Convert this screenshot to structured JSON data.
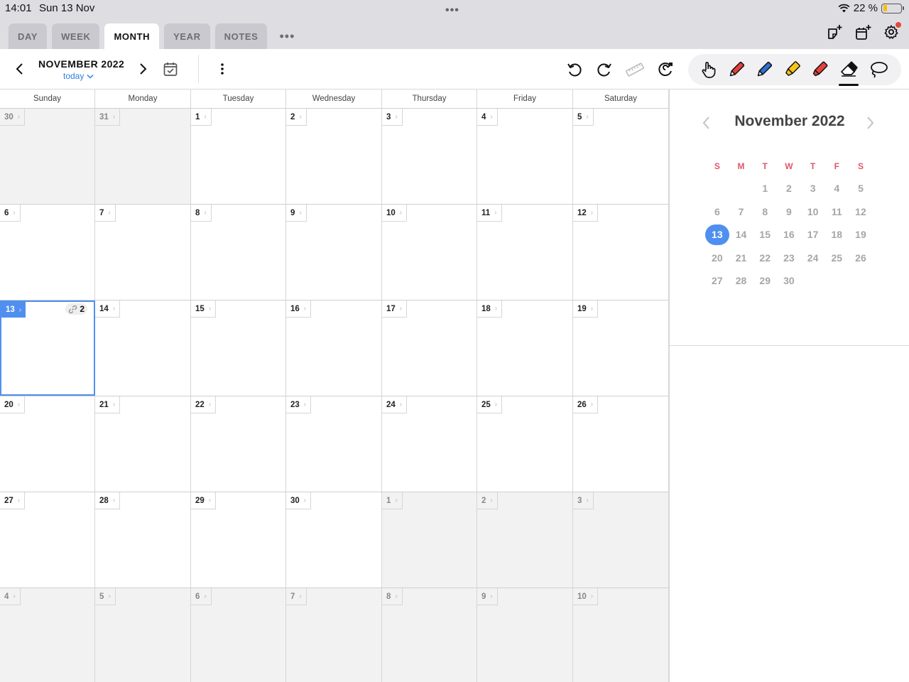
{
  "status": {
    "time": "14:01",
    "date": "Sun 13 Nov",
    "battery_text": "22 %",
    "battery_level": 0.22
  },
  "tabs": [
    {
      "label": "DAY",
      "active": false
    },
    {
      "label": "WEEK",
      "active": false
    },
    {
      "label": "MONTH",
      "active": true
    },
    {
      "label": "YEAR",
      "active": false
    },
    {
      "label": "NOTES",
      "active": false
    }
  ],
  "toolbar": {
    "month_title": "NOVEMBER 2022",
    "today_label": "today"
  },
  "colors": {
    "accent": "#4f8ff0",
    "link": "#2f7de1",
    "weekday_header": "#e0566b",
    "pen_red": "#e5413a",
    "pen_blue": "#2f6fd6",
    "highlighter_yellow": "#f5c518"
  },
  "tools": [
    "hand-icon",
    "red-pen-icon",
    "blue-pen-icon",
    "yellow-highlighter-icon",
    "red-marker-icon",
    "eraser-icon",
    "lasso-icon"
  ],
  "calendar": {
    "weekdays": [
      "Sunday",
      "Monday",
      "Tuesday",
      "Wednesday",
      "Thursday",
      "Friday",
      "Saturday"
    ],
    "weeks": [
      [
        {
          "d": "30",
          "other": true
        },
        {
          "d": "31",
          "other": true
        },
        {
          "d": "1"
        },
        {
          "d": "2"
        },
        {
          "d": "3"
        },
        {
          "d": "4"
        },
        {
          "d": "5"
        }
      ],
      [
        {
          "d": "6"
        },
        {
          "d": "7"
        },
        {
          "d": "8"
        },
        {
          "d": "9"
        },
        {
          "d": "10"
        },
        {
          "d": "11"
        },
        {
          "d": "12"
        }
      ],
      [
        {
          "d": "13",
          "today": true,
          "links": "2"
        },
        {
          "d": "14"
        },
        {
          "d": "15"
        },
        {
          "d": "16"
        },
        {
          "d": "17"
        },
        {
          "d": "18"
        },
        {
          "d": "19"
        }
      ],
      [
        {
          "d": "20"
        },
        {
          "d": "21"
        },
        {
          "d": "22"
        },
        {
          "d": "23"
        },
        {
          "d": "24"
        },
        {
          "d": "25"
        },
        {
          "d": "26"
        }
      ],
      [
        {
          "d": "27"
        },
        {
          "d": "28"
        },
        {
          "d": "29"
        },
        {
          "d": "30"
        },
        {
          "d": "1",
          "other": true
        },
        {
          "d": "2",
          "other": true
        },
        {
          "d": "3",
          "other": true
        }
      ],
      [
        {
          "d": "4",
          "other": true
        },
        {
          "d": "5",
          "other": true
        },
        {
          "d": "6",
          "other": true
        },
        {
          "d": "7",
          "other": true
        },
        {
          "d": "8",
          "other": true
        },
        {
          "d": "9",
          "other": true
        },
        {
          "d": "10",
          "other": true
        }
      ]
    ]
  },
  "mini_calendar": {
    "title": "November 2022",
    "weekdays": [
      "S",
      "M",
      "T",
      "W",
      "T",
      "F",
      "S"
    ],
    "rows": [
      [
        "",
        "",
        "1",
        "2",
        "3",
        "4",
        "5"
      ],
      [
        "6",
        "7",
        "8",
        "9",
        "10",
        "11",
        "12"
      ],
      [
        "13",
        "14",
        "15",
        "16",
        "17",
        "18",
        "19"
      ],
      [
        "20",
        "21",
        "22",
        "23",
        "24",
        "25",
        "26"
      ],
      [
        "27",
        "28",
        "29",
        "30",
        "",
        "",
        ""
      ]
    ],
    "selected": "13"
  }
}
